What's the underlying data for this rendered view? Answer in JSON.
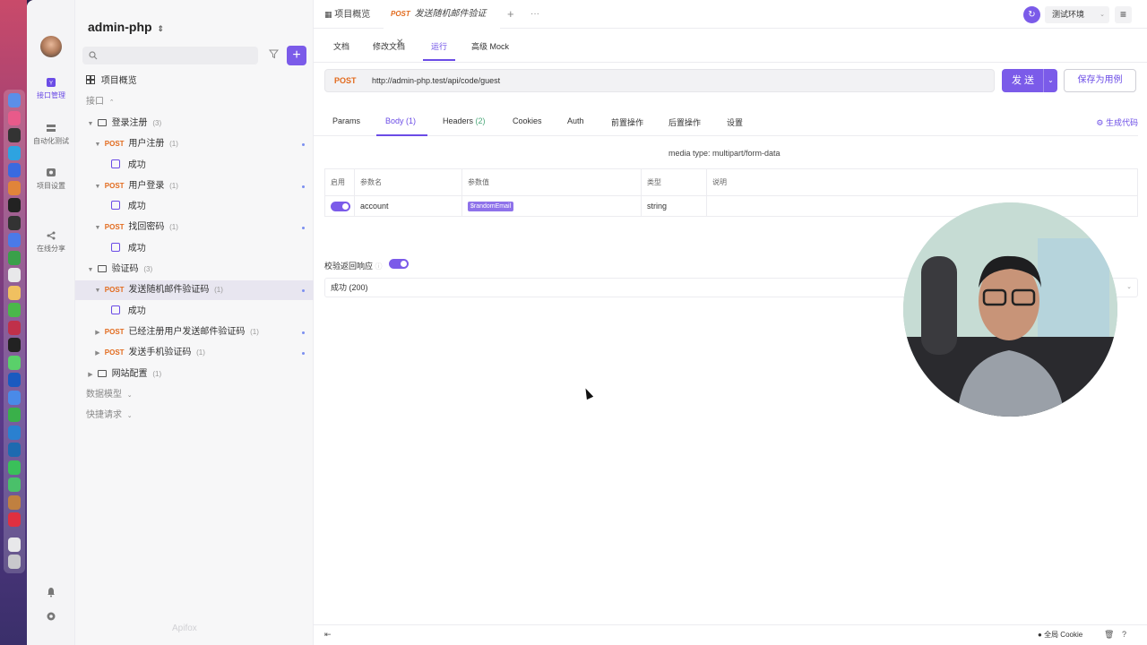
{
  "project": {
    "name": "admin-php",
    "switch_icon": "chevron-updown"
  },
  "rail": {
    "items": [
      {
        "label": "接口管理",
        "icon": "api-icon",
        "active": true
      },
      {
        "label": "自动化测试",
        "icon": "test-icon",
        "active": false
      },
      {
        "label": "项目设置",
        "icon": "settings-icon",
        "active": false
      },
      {
        "label": "在线分享",
        "icon": "share-icon",
        "active": false
      }
    ]
  },
  "sidebar": {
    "overview_label": "项目概览",
    "api_section_label": "接口",
    "tree": [
      {
        "kind": "folder",
        "label": "登录注册",
        "count": "(3)"
      },
      {
        "kind": "api",
        "method": "POST",
        "label": "用户注册",
        "count": "(1)"
      },
      {
        "kind": "case",
        "label": "成功"
      },
      {
        "kind": "api",
        "method": "POST",
        "label": "用户登录",
        "count": "(1)"
      },
      {
        "kind": "case",
        "label": "成功"
      },
      {
        "kind": "api",
        "method": "POST",
        "label": "找回密码",
        "count": "(1)"
      },
      {
        "kind": "case",
        "label": "成功"
      },
      {
        "kind": "folder",
        "label": "验证码",
        "count": "(3)"
      },
      {
        "kind": "api",
        "method": "POST",
        "label": "发送随机邮件验证码",
        "count": "(1)",
        "selected": true
      },
      {
        "kind": "case",
        "label": "成功"
      },
      {
        "kind": "api",
        "method": "POST",
        "label": "已经注册用户发送邮件验证码",
        "count": "(1)"
      },
      {
        "kind": "api",
        "method": "POST",
        "label": "发送手机验证码",
        "count": "(1)"
      },
      {
        "kind": "folder",
        "label": "网站配置",
        "count": "(1)"
      }
    ],
    "models_label": "数据模型",
    "quick_label": "快捷请求",
    "brand": "Apifox"
  },
  "tabs": {
    "overview": "项目概览",
    "active_method": "POST",
    "active_label": "发送随机邮件验证",
    "add": "+",
    "more": "···"
  },
  "env": {
    "label": "测试环境"
  },
  "subtabs": [
    "文档",
    "修改文档",
    "运行",
    "高级 Mock"
  ],
  "request": {
    "method": "POST",
    "url": "http://admin-php.test/api/code/guest",
    "send_label": "发 送",
    "save_label": "保存为用例"
  },
  "req_tabs": [
    {
      "label": "Params",
      "n": ""
    },
    {
      "label": "Body",
      "n": "(1)"
    },
    {
      "label": "Headers",
      "n": "(2)"
    },
    {
      "label": "Cookies",
      "n": ""
    },
    {
      "label": "Auth",
      "n": ""
    },
    {
      "label": "前置操作",
      "n": ""
    },
    {
      "label": "后置操作",
      "n": ""
    },
    {
      "label": "设置",
      "n": ""
    }
  ],
  "gen_code_label": "生成代码",
  "media_type": "media type: multipart/form-data",
  "params_table": {
    "headers": [
      "启用",
      "参数名",
      "参数值",
      "类型",
      "说明"
    ],
    "rows": [
      {
        "enabled": true,
        "name": "account",
        "value": "$randomEmail",
        "type": "string",
        "desc": ""
      }
    ]
  },
  "validate": {
    "label": "校验返回响应",
    "enabled": true,
    "response": "成功 (200)"
  },
  "statusbar": {
    "cookie_label": "全局 Cookie"
  },
  "colors": {
    "accent": "#7b5be9",
    "post": "#e26b1e"
  }
}
